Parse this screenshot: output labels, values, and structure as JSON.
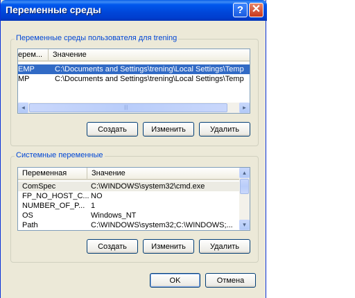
{
  "window": {
    "title": "Переменные среды",
    "help_label": "?",
    "close_label": "✕"
  },
  "user_vars": {
    "group_label": "Переменные среды пользователя для trening",
    "columns": [
      "ерем...",
      "Значение"
    ],
    "rows": [
      {
        "name": "EMP",
        "value": "C:\\Documents and Settings\\trening\\Local Settings\\Temp"
      },
      {
        "name": "MP",
        "value": "C:\\Documents and Settings\\trening\\Local Settings\\Temp"
      }
    ],
    "buttons": {
      "create": "Создать",
      "edit": "Изменить",
      "delete": "Удалить"
    }
  },
  "system_vars": {
    "group_label": "Системные переменные",
    "columns": [
      "Переменная",
      "Значение"
    ],
    "rows": [
      {
        "name": "ComSpec",
        "value": "C:\\WINDOWS\\system32\\cmd.exe"
      },
      {
        "name": "FP_NO_HOST_C...",
        "value": "NO"
      },
      {
        "name": "NUMBER_OF_P...",
        "value": "1"
      },
      {
        "name": "OS",
        "value": "Windows_NT"
      },
      {
        "name": "Path",
        "value": "C:\\WINDOWS\\system32;C:\\WINDOWS;..."
      }
    ],
    "buttons": {
      "create": "Создать",
      "edit": "Изменить",
      "delete": "Удалить"
    }
  },
  "dialog_buttons": {
    "ok": "OK",
    "cancel": "Отмена"
  },
  "icons": {
    "scroll_left": "◂",
    "scroll_right": "▸",
    "scroll_up": "▴",
    "scroll_down": "▾",
    "grip": "|||"
  },
  "colors": {
    "titlebar": "#0058ee",
    "selection": "#316ac5",
    "group_label": "#0046d5",
    "dialog_bg": "#ece9d8"
  }
}
